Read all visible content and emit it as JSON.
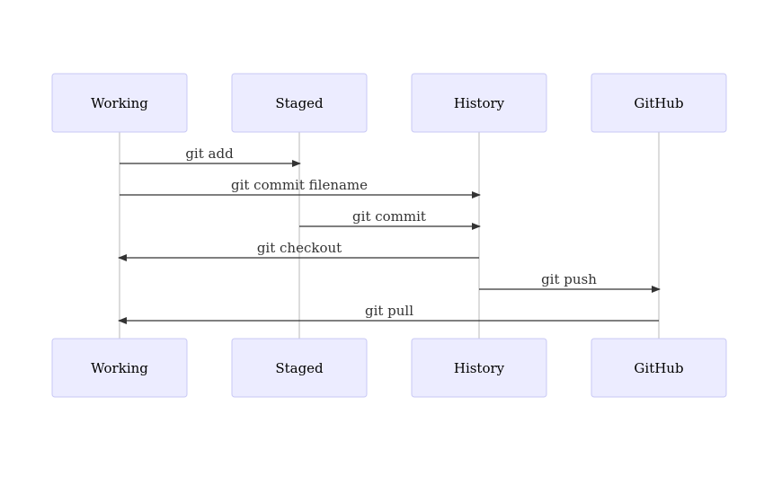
{
  "diagram": {
    "type": "sequence",
    "participants": [
      "Working",
      "Staged",
      "History",
      "GitHub"
    ],
    "messages": [
      {
        "from": "Working",
        "to": "Staged",
        "label": "git add"
      },
      {
        "from": "Working",
        "to": "History",
        "label": "git commit filename"
      },
      {
        "from": "Staged",
        "to": "History",
        "label": "git commit"
      },
      {
        "from": "History",
        "to": "Working",
        "label": "git checkout"
      },
      {
        "from": "History",
        "to": "GitHub",
        "label": "git push"
      },
      {
        "from": "GitHub",
        "to": "Working",
        "label": "git pull"
      }
    ],
    "colors": {
      "actor_fill": "#ECECFF",
      "actor_border": "#C9C9F5",
      "line": "#333333",
      "lifeline": "#D0D0D0"
    }
  }
}
